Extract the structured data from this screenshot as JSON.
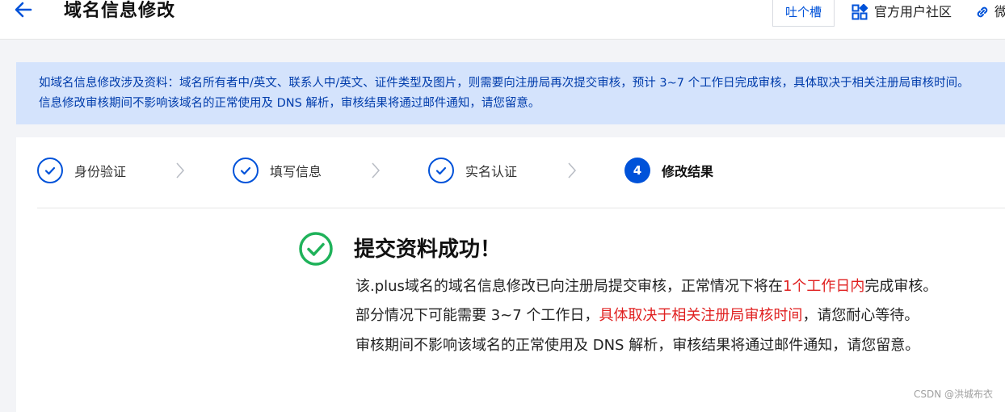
{
  "header": {
    "title": "域名信息修改",
    "feedback_label": "吐个槽",
    "community_label": "官方用户社区",
    "wechat_label": "微"
  },
  "notice": {
    "line1": "如域名信息修改涉及资料：域名所有者中/英文、联系人中/英文、证件类型及图片，则需要向注册局再次提交审核，预计 3~7 个工作日完成审核，具体取决于相关注册局审核时间。",
    "line2": "信息修改审核期间不影响该域名的正常使用及 DNS 解析，审核结果将通过邮件通知，请您留意。"
  },
  "steps": [
    {
      "label": "身份验证",
      "status": "done"
    },
    {
      "label": "填写信息",
      "status": "done"
    },
    {
      "label": "实名认证",
      "status": "done"
    },
    {
      "label": "修改结果",
      "status": "current",
      "number": "4"
    }
  ],
  "result": {
    "title": "提交资料成功！",
    "line1_before": "该.plus域名的域名信息修改已向注册局提交审核，正常情况下将在",
    "line1_highlight": "1个工作日内",
    "line1_after": "完成审核。",
    "line2_before": "部分情况下可能需要 3~7 个工作日，",
    "line2_highlight": "具体取决于相关注册局审核时间",
    "line2_after": "，请您耐心等待。",
    "line3": "审核期间不影响该域名的正常使用及 DNS 解析，审核结果将通过邮件通知，请您留意。"
  },
  "watermark": "CSDN @洪城布衣",
  "colors": {
    "primary": "#0052d9",
    "success": "#1fb25a",
    "highlight": "#e02020",
    "notice_bg": "#d4e3fc"
  }
}
